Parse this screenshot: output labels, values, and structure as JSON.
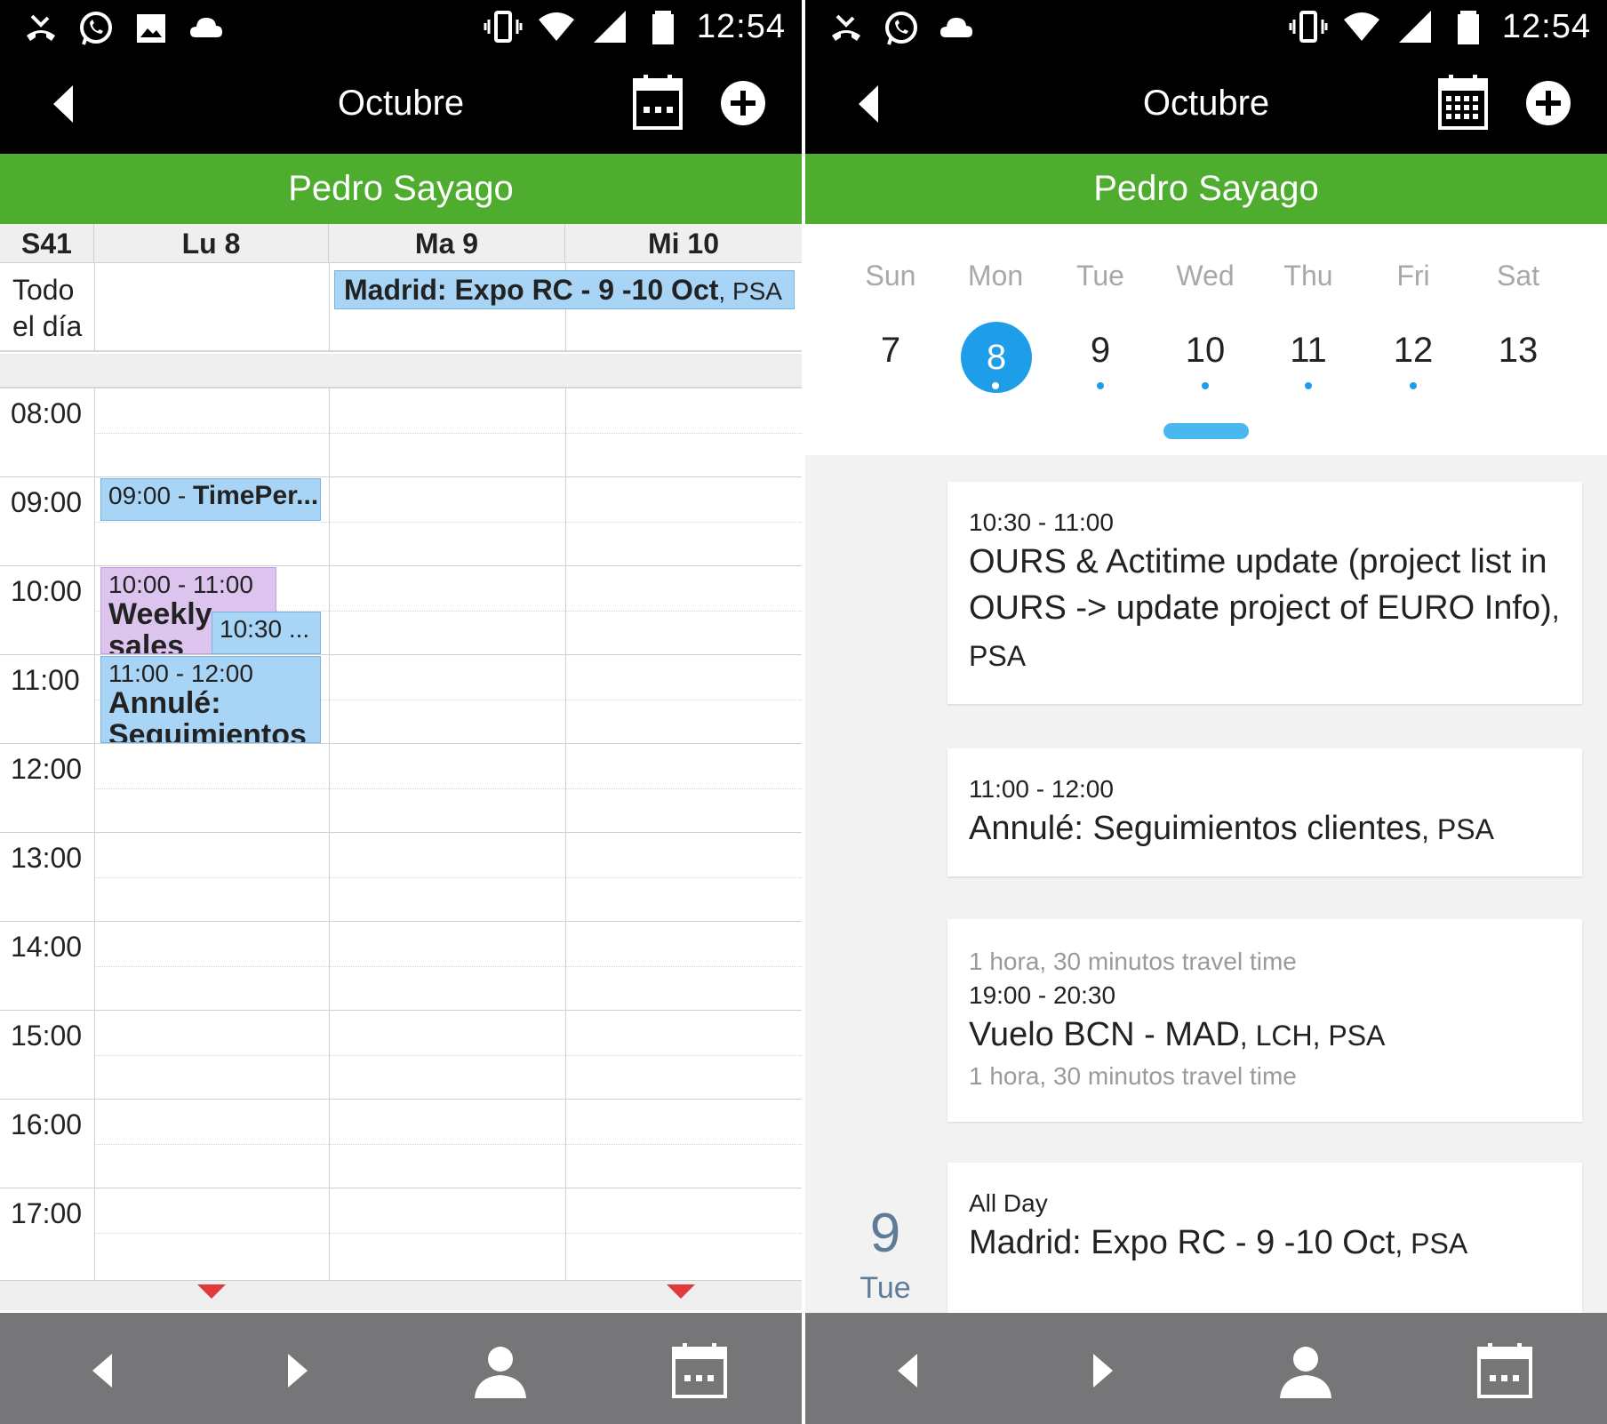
{
  "status_bar": {
    "time": "12:54"
  },
  "app": {
    "month_title": "Octubre",
    "user_name": "Pedro Sayago"
  },
  "week_view": {
    "week_label": "S41",
    "days": [
      "Lu 8",
      "Ma 9",
      "Mi 10"
    ],
    "allday_label_line1": "Todo",
    "allday_label_line2": "el día",
    "allday_event": {
      "title": "Madrid: Expo RC - 9 -10 Oct",
      "suffix": ", PSA"
    },
    "hours": [
      "08:00",
      "09:00",
      "10:00",
      "11:00",
      "12:00",
      "13:00",
      "14:00",
      "15:00",
      "16:00",
      "17:00"
    ],
    "events": [
      {
        "time": "09:00 -",
        "title": "TimePer..."
      },
      {
        "time": "10:00 - 11:00",
        "title": "Weekly sales"
      },
      {
        "time": "10:30 ...",
        "title": ""
      },
      {
        "time": "11:00 - 12:00",
        "title": "Annulé: Seguimientos"
      }
    ]
  },
  "agenda_view": {
    "days_of_week": [
      "Sun",
      "Mon",
      "Tue",
      "Wed",
      "Thu",
      "Fri",
      "Sat"
    ],
    "dates": [
      "7",
      "8",
      "9",
      "10",
      "11",
      "12",
      "13"
    ],
    "selected_index": 1,
    "dots_on": [
      1,
      2,
      3,
      4,
      5
    ],
    "cards": [
      {
        "time": "10:30 - 11:00",
        "title": "OURS & Actitime update (project list in OURS -> update project of EURO Info)",
        "suffix": ", PSA"
      },
      {
        "time": "11:00 - 12:00",
        "title": "Annulé: Seguimientos clientes",
        "suffix": ", PSA"
      },
      {
        "travel_before": "1 hora, 30 minutos travel time",
        "time": "19:00 - 20:30",
        "title": "Vuelo BCN - MAD",
        "suffix": ", LCH, PSA",
        "travel_after": "1 hora, 30 minutos travel time"
      },
      {
        "time": "All Day",
        "title": "Madrid: Expo RC - 9 -10 Oct",
        "suffix": ", PSA"
      }
    ],
    "section_day_number": "9",
    "section_day_name": "Tue"
  },
  "colors": {
    "accent_green": "#4ead2f",
    "event_blue": "#a8d4f5",
    "event_purple": "#dcc4ef",
    "selected_date": "#1e9ee8",
    "bottom_bar": "#767678"
  }
}
